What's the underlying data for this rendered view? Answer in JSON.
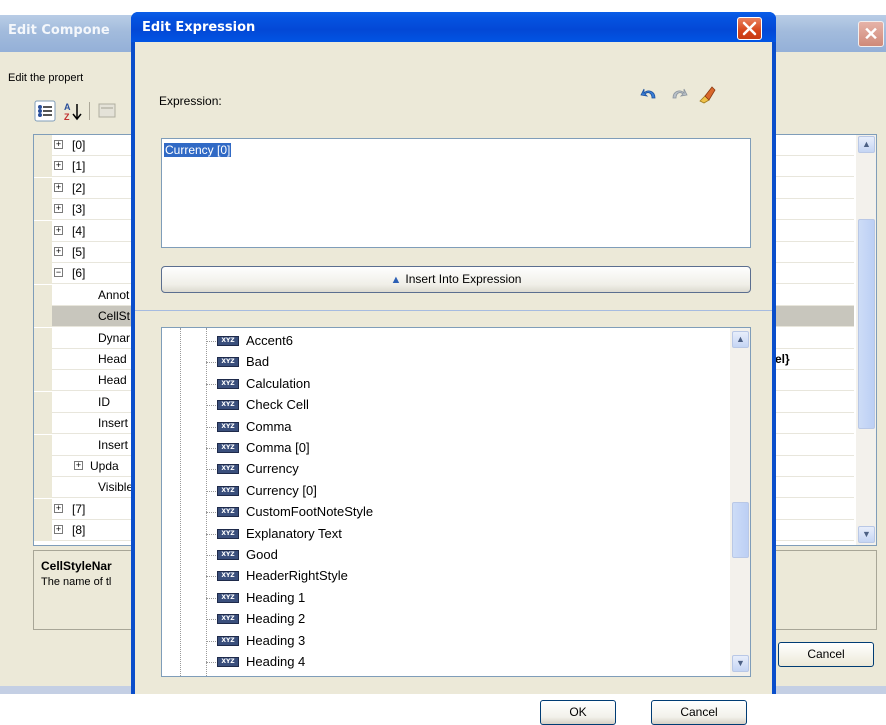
{
  "background_window": {
    "title": "Edit Compone",
    "description": "Edit the propert",
    "grid_rows": [
      {
        "label": "[0]",
        "expander": "+"
      },
      {
        "label": "[1]",
        "expander": "+"
      },
      {
        "label": "[2]",
        "expander": "+"
      },
      {
        "label": "[3]",
        "expander": "+"
      },
      {
        "label": "[4]",
        "expander": "+"
      },
      {
        "label": "[5]",
        "expander": "+"
      },
      {
        "label": "[6]",
        "expander": "−"
      },
      {
        "label": "Annot",
        "expander": ""
      },
      {
        "label": "CellSt",
        "expander": ""
      },
      {
        "label": "Dynar",
        "expander": ""
      },
      {
        "label": "Head",
        "expander": ""
      },
      {
        "label": "Head",
        "expander": ""
      },
      {
        "label": "ID",
        "expander": ""
      },
      {
        "label": "Insert",
        "expander": ""
      },
      {
        "label": "Insert",
        "expander": ""
      },
      {
        "label": "Upda",
        "expander": "+"
      },
      {
        "label": "Visible",
        "expander": ""
      },
      {
        "label": "[7]",
        "expander": "+"
      },
      {
        "label": "[8]",
        "expander": "+"
      }
    ],
    "right_value": "el}",
    "help_title": "CellStyleNar",
    "help_text": "The name of tl",
    "cancel_label": "Cancel"
  },
  "dialog": {
    "title": "Edit Expression",
    "expression_label": "Expression:",
    "expression_value": "Currency [0]",
    "insert_button_label": "Insert Into Expression",
    "style_items": [
      "Accent6",
      "Bad",
      "Calculation",
      "Check Cell",
      "Comma",
      "Comma [0]",
      "Currency",
      "Currency [0]",
      "CustomFootNoteStyle",
      "Explanatory Text",
      "Good",
      "HeaderRightStyle",
      "Heading 1",
      "Heading 2",
      "Heading 3",
      "Heading 4"
    ],
    "item_icon": "style-icon",
    "ok_label": "OK",
    "cancel_label": "Cancel"
  }
}
